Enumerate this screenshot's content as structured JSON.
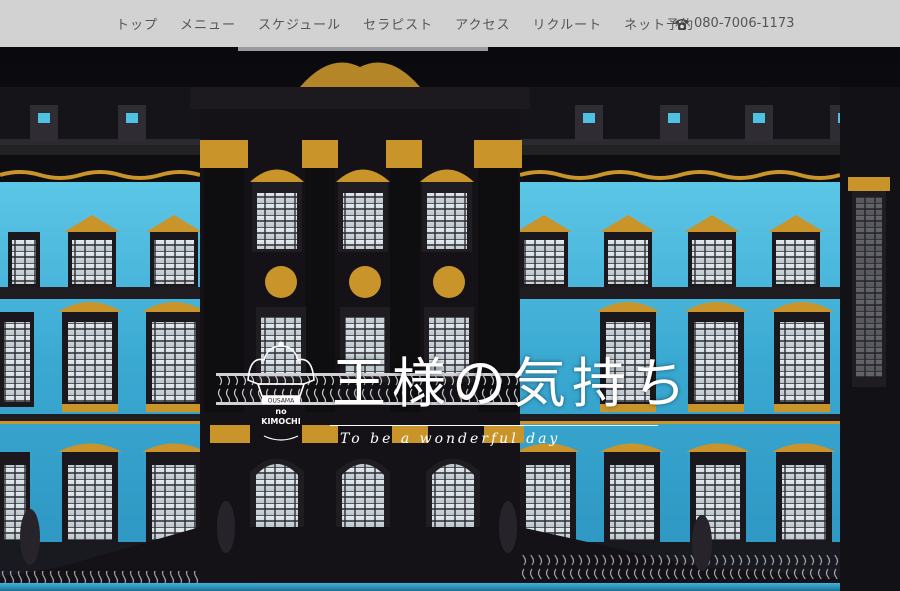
{
  "nav": {
    "items": [
      {
        "label": "トップ"
      },
      {
        "label": "メニュー"
      },
      {
        "label": "スケジュール"
      },
      {
        "label": "セラピスト"
      },
      {
        "label": "アクセス"
      },
      {
        "label": "リクルート"
      },
      {
        "label": "ネット予約"
      }
    ],
    "phone": "080-7006-1173",
    "phone_icon": "telephone-icon"
  },
  "hero": {
    "image": "palace-facade-photo"
  },
  "logo": {
    "crown_icon": "crown-icon",
    "mark_top": "OUSAMA",
    "mark_mid": "no",
    "mark_bottom": "KIMOCHI",
    "title": "王様の気持ち",
    "tagline": "To be a wonderful day"
  },
  "colors": {
    "nav_bg": "#e2e2e2",
    "nav_text": "#555555",
    "facade_blue": "#3fb1d6",
    "gold": "#c9952a",
    "dark": "#141216"
  }
}
